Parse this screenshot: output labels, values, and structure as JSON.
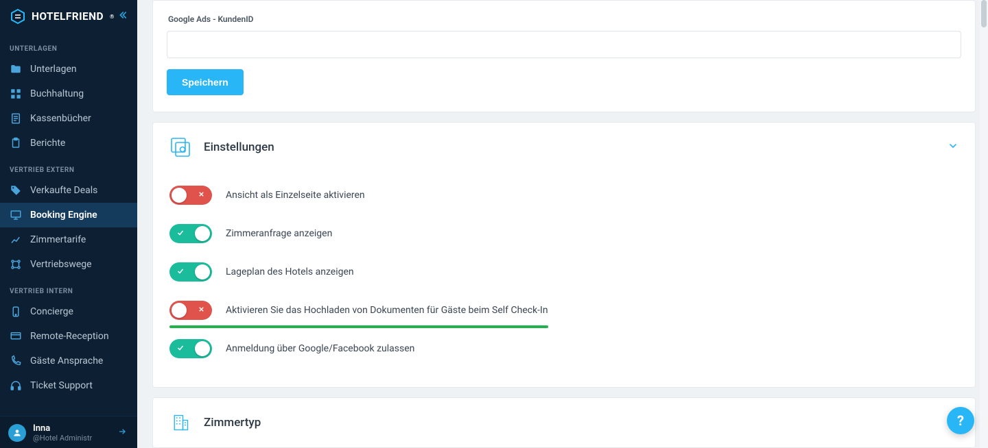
{
  "brand": {
    "name": "HOTELFRIEND",
    "trademark": "®"
  },
  "sidebar": {
    "groups": [
      {
        "title": "UNTERLAGEN",
        "items": [
          {
            "label": "Unterlagen",
            "icon": "folder-icon"
          },
          {
            "label": "Buchhaltung",
            "icon": "grid-icon"
          },
          {
            "label": "Kassenbücher",
            "icon": "doc-icon"
          },
          {
            "label": "Berichte",
            "icon": "clipboard-icon"
          }
        ]
      },
      {
        "title": "VERTRIEB EXTERN",
        "items": [
          {
            "label": "Verkaufte Deals",
            "icon": "tag-icon"
          },
          {
            "label": "Booking Engine",
            "icon": "monitor-icon",
            "active": true
          },
          {
            "label": "Zimmertarife",
            "icon": "chart-icon"
          },
          {
            "label": "Vertriebswege",
            "icon": "network-icon"
          }
        ]
      },
      {
        "title": "VERTRIEB INTERN",
        "items": [
          {
            "label": "Concierge",
            "icon": "mobile-icon"
          },
          {
            "label": "Remote-Reception",
            "icon": "screen-icon"
          },
          {
            "label": "Gäste Ansprache",
            "icon": "phone-icon"
          },
          {
            "label": "Ticket Support",
            "icon": "headset-icon"
          }
        ]
      }
    ],
    "user": {
      "name": "Inna",
      "role": "@Hotel Administr"
    }
  },
  "form": {
    "ga_label": "Google Ads - KundenID",
    "ga_value": "",
    "save_label": "Speichern"
  },
  "settings": {
    "title": "Einstellungen",
    "rows": [
      {
        "on": false,
        "label": "Ansicht als Einzelseite aktivieren"
      },
      {
        "on": true,
        "label": "Zimmeranfrage anzeigen"
      },
      {
        "on": true,
        "label": "Lageplan des Hotels anzeigen"
      },
      {
        "on": false,
        "label": "Aktivieren Sie das Hochladen von Dokumenten für Gäste beim Self Check-In",
        "highlight": true
      },
      {
        "on": true,
        "label": "Anmeldung über Google/Facebook zulassen"
      }
    ]
  },
  "room_type": {
    "title": "Zimmertyp"
  },
  "help": {
    "glyph": "?"
  }
}
